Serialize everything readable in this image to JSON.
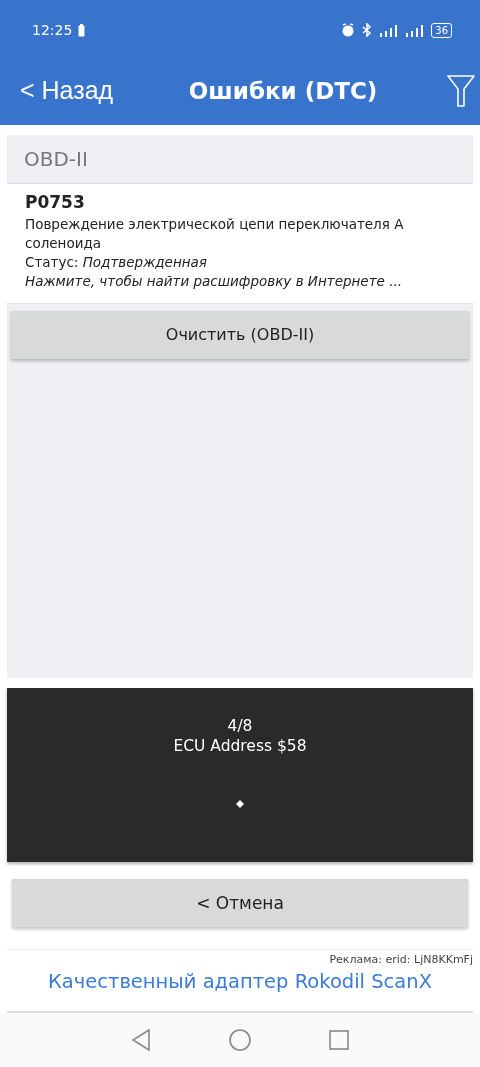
{
  "status_bar": {
    "time": "12:25",
    "battery": "36"
  },
  "header": {
    "back": "< Назад",
    "title": "Ошибки (DTC)"
  },
  "section": {
    "title": "OBD-II"
  },
  "dtc": {
    "code": "P0753",
    "description": "Повреждение электрической цепи переключателя A соленоида",
    "status_label": "Статус:",
    "status": "Подтвержденная",
    "hint": "Нажмите, чтобы найти расшифровку в Интернете ..."
  },
  "clear_button": "Очистить (OBD-II)",
  "progress": {
    "step": "4/8",
    "address": "ECU Address $58"
  },
  "cancel_button": "< Отмена",
  "ad": {
    "label": "Реклама: erid: LjN8KKmFj",
    "link": "Качественный адаптер Rokodil ScanX"
  }
}
